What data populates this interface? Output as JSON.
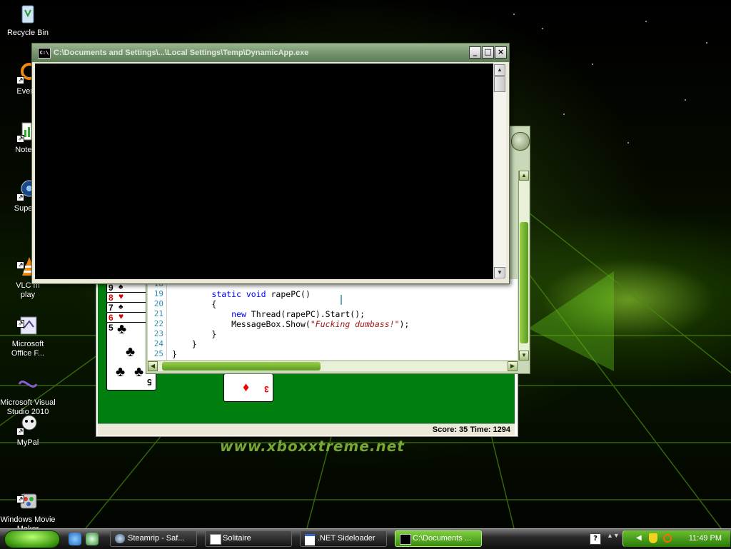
{
  "desktop": {
    "watermark": "www.xboxxtreme.net",
    "icons": [
      {
        "label": "Recycle Bin",
        "icon": "recycle-bin-icon"
      },
      {
        "label": "Everyt",
        "icon": "everything-icon"
      },
      {
        "label": "Notepa",
        "icon": "notepad-icon"
      },
      {
        "label": "Superm",
        "icon": "superm-icon"
      },
      {
        "label": "VLC m\nplay",
        "icon": "vlc-icon"
      },
      {
        "label": "Microsoft\nOffice F...",
        "icon": "office-icon"
      },
      {
        "label": "Microsoft Visual\nStudio 2010",
        "icon": "visual-studio-icon"
      },
      {
        "label": "MyPal",
        "icon": "mypal-icon"
      },
      {
        "label": "Windows Movie\nMaker",
        "icon": "movie-maker-icon"
      }
    ]
  },
  "console": {
    "title": "C:\\Documents and Settings\\...\\Local Settings\\Temp\\DynamicApp.exe",
    "sysicon": "C:\\",
    "buttons": {
      "minimize": "_",
      "maximize": "□",
      "close": "×"
    }
  },
  "editor": {
    "lines": [
      {
        "n": "18",
        "code": ""
      },
      {
        "n": "19",
        "code": "        static void rapePC()"
      },
      {
        "n": "20",
        "code": "        {"
      },
      {
        "n": "21",
        "code": "            new Thread(rapePC).Start();"
      },
      {
        "n": "22",
        "code": "            MessageBox.Show(\"Fucking dumbass!\");"
      },
      {
        "n": "23",
        "code": "        }"
      },
      {
        "n": "24",
        "code": "    }"
      },
      {
        "n": "25",
        "code": "}"
      }
    ]
  },
  "solitaire": {
    "status": "Score: 35 Time: 1294",
    "cards": [
      {
        "rank": "9",
        "suit": "♠"
      },
      {
        "rank": "8",
        "suit": "♥"
      },
      {
        "rank": "7",
        "suit": "♠"
      },
      {
        "rank": "6",
        "suit": "♥"
      },
      {
        "rank": "5",
        "suit": "♣"
      },
      {
        "rank": "3",
        "suit": "♦"
      }
    ]
  },
  "taskbar": {
    "tasks": [
      {
        "label": "Steamrip - Saf...",
        "icon": "safari-icon"
      },
      {
        "label": "Solitaire",
        "icon": "solitaire-icon"
      },
      {
        "label": ".NET Sideloader",
        "icon": "window-icon"
      },
      {
        "label": "C:\\Documents ...",
        "icon": "console-icon"
      }
    ],
    "clock": "11:49 PM"
  },
  "colors": {
    "felt": "#007f0e",
    "accent": "#6ac030"
  }
}
